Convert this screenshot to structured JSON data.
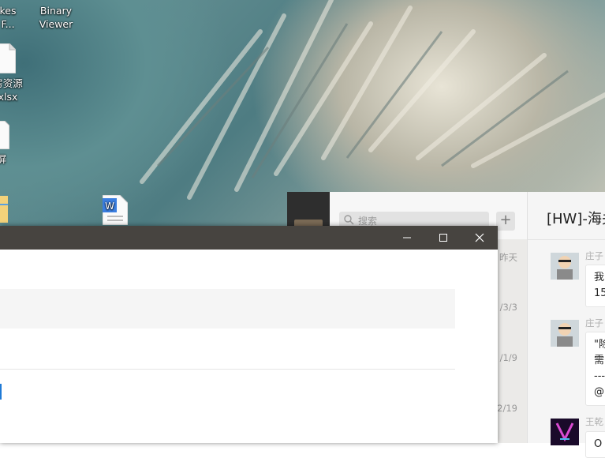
{
  "desktop": {
    "icons": [
      {
        "name": "desktop-icon-partial-1",
        "label": "kes\nF..."
      },
      {
        "name": "desktop-icon-binary-viewer",
        "label": "Binary\nViewer"
      },
      {
        "name": "desktop-icon-xlsx-file",
        "label": "房资源\nxlsx"
      },
      {
        "name": "desktop-icon-partial-3",
        "label": "屏"
      }
    ]
  },
  "chat": {
    "search_placeholder": "搜索",
    "add_button": "+",
    "title": "[HW]-海关",
    "conversation_dates": [
      "昨天",
      "/3/3",
      "/1/9",
      "2/19"
    ],
    "messages": [
      {
        "sender": "庄子",
        "text": "我\n15"
      },
      {
        "sender": "庄子",
        "text": "\"除\n需\n---\n@"
      },
      {
        "sender": "王乾",
        "text": "O"
      }
    ]
  },
  "dialog": {
    "buttons": {
      "minimize": "minimize",
      "maximize": "maximize",
      "close": "close"
    }
  },
  "colors": {
    "titlebar": "#474440",
    "accent": "#1f7ad6",
    "chat_sidebar": "#2e2e2e"
  }
}
